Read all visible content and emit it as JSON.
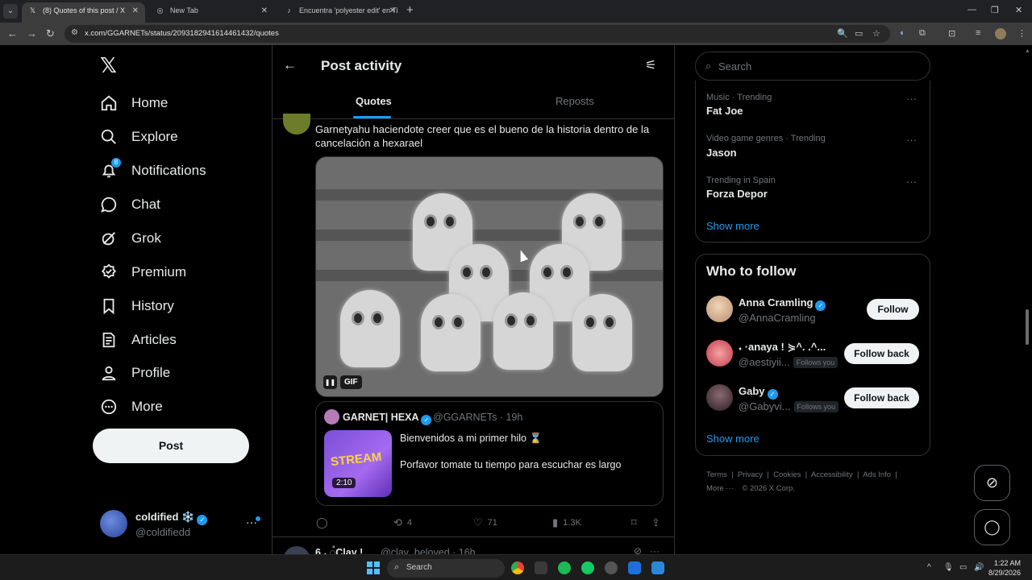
{
  "browser": {
    "tabs": [
      {
        "title": "(8) Quotes of this post / X",
        "active": true
      },
      {
        "title": "New Tab",
        "active": false
      },
      {
        "title": "Encuentra 'polyester edit' en Ti",
        "active": false
      }
    ],
    "url": "x.com/GGARNETs/status/2093182941614461432/quotes"
  },
  "sidebar": {
    "items": [
      {
        "label": "Home",
        "icon": "home-icon"
      },
      {
        "label": "Explore",
        "icon": "search-icon"
      },
      {
        "label": "Notifications",
        "icon": "bell-icon",
        "badge": "8"
      },
      {
        "label": "Chat",
        "icon": "chat-icon"
      },
      {
        "label": "Grok",
        "icon": "grok-icon"
      },
      {
        "label": "Premium",
        "icon": "premium-icon"
      },
      {
        "label": "History",
        "icon": "bookmark-icon"
      },
      {
        "label": "Articles",
        "icon": "articles-icon"
      },
      {
        "label": "Profile",
        "icon": "person-icon"
      },
      {
        "label": "More",
        "icon": "more-circle-icon"
      }
    ],
    "post_label": "Post",
    "account": {
      "name": "coldified ❄️",
      "handle": "@coldifiedd"
    }
  },
  "header": {
    "title": "Post activity"
  },
  "tabs": {
    "quotes": "Quotes",
    "reposts": "Reposts"
  },
  "quote_post": {
    "text": "Garnetyahu haciendote creer que es el bueno de la historia dentro de la cancelación a hexarael",
    "gif_label": "GIF",
    "quoted": {
      "name": "GARNET| HEXA",
      "handle": "@GGARNETs · 19h",
      "line1": "Bienvenidos a mi primer hilo ⌛",
      "line2": "Porfavor tomate tu tiempo para escuchar es largo",
      "duration": "2:10",
      "thumb_text": "STREAM"
    },
    "actions": {
      "replies": "",
      "reposts": "4",
      "likes": "71",
      "views": "1.3K"
    }
  },
  "next_post": {
    "name": "6 𝆺 ◌̊Clay !",
    "handle": "@clay_beloved · 16h"
  },
  "search": {
    "placeholder": "Search"
  },
  "trends": [
    {
      "meta": "Music · Trending",
      "name": "Fat Joe"
    },
    {
      "meta": "Video game genres · Trending",
      "name": "Jason"
    },
    {
      "meta": "Trending in Spain",
      "name": "Forza Depor"
    }
  ],
  "show_more": "Show more",
  "who_to_follow": {
    "title": "Who to follow",
    "users": [
      {
        "name": "Anna Cramling",
        "handle": "@AnnaCramling",
        "button": "Follow",
        "follows_you": ""
      },
      {
        "name": "𝆺 ·anaya ! ⋟^. .^...",
        "handle": "@aestiyii...",
        "button": "Follow back",
        "follows_you": "Follows you"
      },
      {
        "name": "Gaby",
        "handle": "@Gabyvi...",
        "button": "Follow back",
        "follows_you": "Follows you"
      }
    ]
  },
  "footer": {
    "links": [
      "Terms",
      "Privacy",
      "Cookies",
      "Accessibility",
      "Ads Info"
    ],
    "more": "More ···",
    "copyright": "© 2026 X Corp."
  },
  "taskbar": {
    "search": "Search",
    "time": "1:22 AM",
    "date": "8/29/2026"
  },
  "colors": {
    "accent": "#1d9bf0",
    "background": "#000000",
    "border": "#2f3336"
  }
}
